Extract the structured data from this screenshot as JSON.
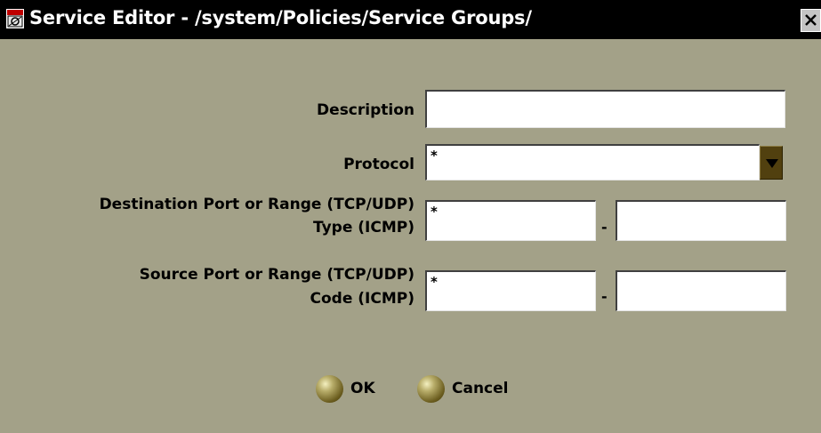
{
  "window": {
    "title": "Service Editor - /system/Policies/Service Groups/",
    "close_glyph": "×",
    "app_icon": "service-editor-app-icon"
  },
  "form": {
    "description": {
      "label": "Description",
      "value": ""
    },
    "protocol": {
      "label": "Protocol",
      "value": "*",
      "icon": "chevron-down-icon"
    },
    "destination": {
      "label_line1": "Destination Port or Range (TCP/UDP)",
      "label_line2": "Type (ICMP)",
      "from_value": "*",
      "separator": "-",
      "to_value": ""
    },
    "source": {
      "label_line1": "Source Port or Range (TCP/UDP)",
      "label_line2": "Code (ICMP)",
      "from_value": "*",
      "separator": "-",
      "to_value": ""
    }
  },
  "buttons": {
    "ok": {
      "label": "OK"
    },
    "cancel": {
      "label": "Cancel"
    }
  },
  "colors": {
    "window_background": "#a3a188",
    "titlebar": "#000000",
    "dropdown_button": "#51400f",
    "button_knob": "#6a5c1e"
  }
}
